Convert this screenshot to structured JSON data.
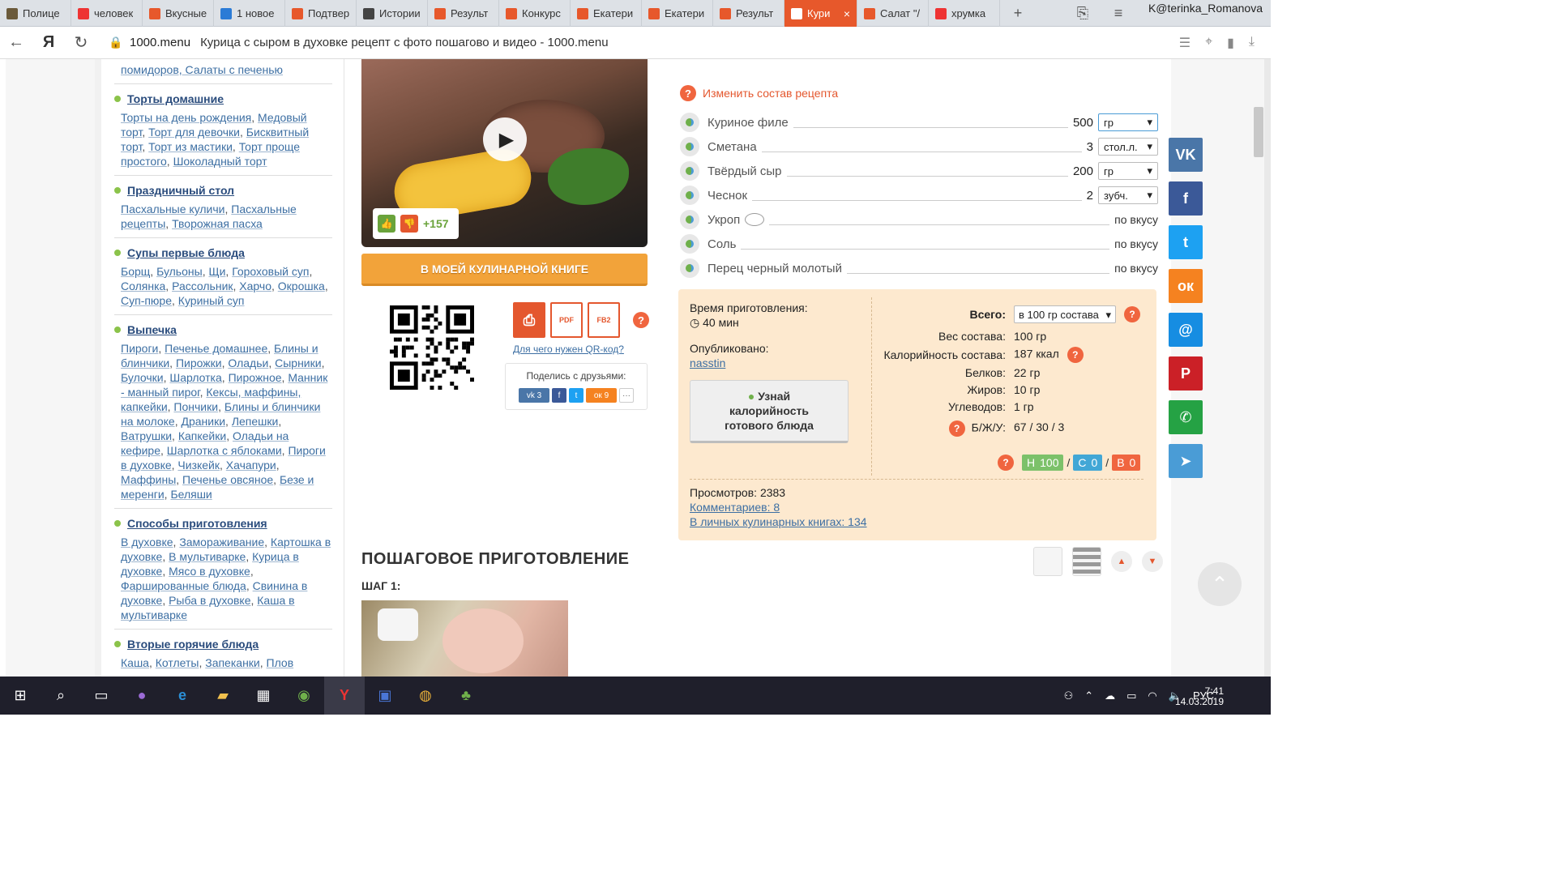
{
  "browser": {
    "tabs": [
      {
        "title": "Полице",
        "icon": "police-favicon",
        "color": "#6b5a3a"
      },
      {
        "title": "человек",
        "icon": "yandex-favicon",
        "color": "#e33"
      },
      {
        "title": "Вкусные",
        "icon": "1000menu-favicon",
        "color": "#e7582b"
      },
      {
        "title": "1 новое",
        "icon": "mail-favicon",
        "color": "#2b7bd6"
      },
      {
        "title": "Подтвер",
        "icon": "1000menu-favicon",
        "color": "#e7582b"
      },
      {
        "title": "Истории",
        "icon": "history-favicon",
        "color": "#444"
      },
      {
        "title": "Результ",
        "icon": "1000menu-favicon",
        "color": "#e7582b"
      },
      {
        "title": "Конкурс",
        "icon": "1000menu-favicon",
        "color": "#e7582b"
      },
      {
        "title": "Екатери",
        "icon": "1000menu-favicon",
        "color": "#e7582b"
      },
      {
        "title": "Екатери",
        "icon": "1000menu-favicon",
        "color": "#e7582b"
      },
      {
        "title": "Результ",
        "icon": "1000menu-favicon",
        "color": "#e7582b"
      },
      {
        "title": "Кури",
        "icon": "1000menu-favicon",
        "color": "#fff",
        "active": true
      },
      {
        "title": "Салат \"/",
        "icon": "1000menu-favicon",
        "color": "#e7582b"
      },
      {
        "title": "хрумка",
        "icon": "yandex-favicon",
        "color": "#e33"
      }
    ],
    "user": "K@terinka_Romanova",
    "domain": "1000.menu",
    "page_title": "Курица с сыром в духовке рецепт с фото пошагово и видео - 1000.menu"
  },
  "sidebar": {
    "top_links": "помидоров, Салаты с печенью",
    "categories": [
      {
        "title": "Торты домашние",
        "links": [
          "Торты на день рождения",
          "Медовый торт",
          "Торт для девочки",
          "Бисквитный торт",
          "Торт из мастики",
          "Торт проще простого",
          "Шоколадный торт"
        ]
      },
      {
        "title": "Праздничный стол",
        "links": [
          "Пасхальные куличи",
          "Пасхальные рецепты",
          "Творожная пасха"
        ]
      },
      {
        "title": "Супы первые блюда",
        "links": [
          "Борщ",
          "Бульоны",
          "Щи",
          "Гороховый суп",
          "Солянка",
          "Рассольник",
          "Харчо",
          "Окрошка",
          "Суп-пюре",
          "Куриный суп"
        ]
      },
      {
        "title": "Выпечка",
        "links": [
          "Пироги",
          "Печенье домашнее",
          "Блины и блинчики",
          "Пирожки",
          "Оладьи",
          "Сырники",
          "Булочки",
          "Шарлотка",
          "Пирожное",
          "Манник - манный пирог",
          "Кексы, маффины, капкейки",
          "Пончики",
          "Блины и блинчики на молоке",
          "Драники",
          "Лепешки",
          "Ватрушки",
          "Капкейки",
          "Оладьи на кефире",
          "Шарлотка с яблоками",
          "Пироги в духовке",
          "Чизкейк",
          "Хачапури",
          "Маффины",
          "Печенье овсяное",
          "Безе и меренги",
          "Беляши"
        ]
      },
      {
        "title": "Способы приготовления",
        "links": [
          "В духовке",
          "Замораживание",
          "Картошка в духовке",
          "В мультиварке",
          "Курица в духовке",
          "Мясо в духовке",
          "Фаршированные блюда",
          "Свинина в духовке",
          "Рыба в духовке",
          "Каша в мультиварке"
        ]
      },
      {
        "title": "Вторые горячие блюда",
        "links": [
          "Каша",
          "Котлеты",
          "Запеканки",
          "Плов"
        ]
      }
    ]
  },
  "recipe": {
    "votes": "+157",
    "cookbook_button": "В МОЕЙ КУЛИНАРНОЙ КНИГЕ",
    "qr_link": "Для чего нужен QR-код?",
    "share_title": "Поделись с друзьями:",
    "share_counts": {
      "vk": "3",
      "ok": "9"
    },
    "print_labels": {
      "pdf": "PDF",
      "fb2": "FB2"
    },
    "change_link": "Изменить состав рецепта",
    "ingredients": [
      {
        "name": "Куриное филе",
        "qty": "500",
        "unit": "гр"
      },
      {
        "name": "Сметана",
        "qty": "3",
        "unit": "стол.л."
      },
      {
        "name": "Твёрдый сыр",
        "qty": "200",
        "unit": "гр"
      },
      {
        "name": "Чеснок",
        "qty": "2",
        "unit": "зубч."
      },
      {
        "name": "Укроп",
        "taste": "по вкусу"
      },
      {
        "name": "Соль",
        "taste": "по вкусу"
      },
      {
        "name": "Перец черный молотый",
        "taste": "по вкусу"
      }
    ],
    "time_label": "Время приготовления:",
    "time_value": "40 мин",
    "published_label": "Опубликовано:",
    "author": "nasstin",
    "calorie_button": [
      "Узнай",
      "калорийность",
      "готового блюда"
    ],
    "total_label": "Всего:",
    "total_select": "в 100 гр состава",
    "nutrition": [
      {
        "k": "Вес состава:",
        "v": "100 гр"
      },
      {
        "k": "Калорийность состава:",
        "v": "187 ккал"
      },
      {
        "k": "Белков:",
        "v": "22 гр"
      },
      {
        "k": "Жиров:",
        "v": "10 гр"
      },
      {
        "k": "Углеводов:",
        "v": "1 гр"
      },
      {
        "k": "Б/Ж/У:",
        "v": "67 / 30 / 3"
      }
    ],
    "tags": [
      {
        "label": "Н",
        "value": "100",
        "color": "#7cc16a"
      },
      {
        "label": "С",
        "value": "0",
        "color": "#42a7d6"
      },
      {
        "label": "В",
        "value": "0",
        "color": "#f0653f"
      }
    ],
    "views": "Просмотров: 2383",
    "comments": "Комментариев: 8",
    "books": "В личных кулинарных книгах: 134",
    "steps_title": "ПОШАГОВОЕ ПРИГОТОВЛЕНИЕ",
    "step1": "ШАГ 1:"
  },
  "social": [
    {
      "name": "vk",
      "glyph": "VK",
      "color": "#4a76a8"
    },
    {
      "name": "facebook",
      "glyph": "f",
      "color": "#3b5998"
    },
    {
      "name": "twitter",
      "glyph": "t",
      "color": "#1da1f2"
    },
    {
      "name": "odnoklassniki",
      "glyph": "ок",
      "color": "#f58220"
    },
    {
      "name": "moimir",
      "glyph": "@",
      "color": "#168de2"
    },
    {
      "name": "pinterest",
      "glyph": "P",
      "color": "#cb2027"
    },
    {
      "name": "whatsapp",
      "glyph": "✆",
      "color": "#25a244"
    },
    {
      "name": "telegram",
      "glyph": "➤",
      "color": "#4a9cd6"
    }
  ],
  "taskbar": {
    "lang": "РУС",
    "time": "7:41",
    "date": "14.03.2019"
  }
}
